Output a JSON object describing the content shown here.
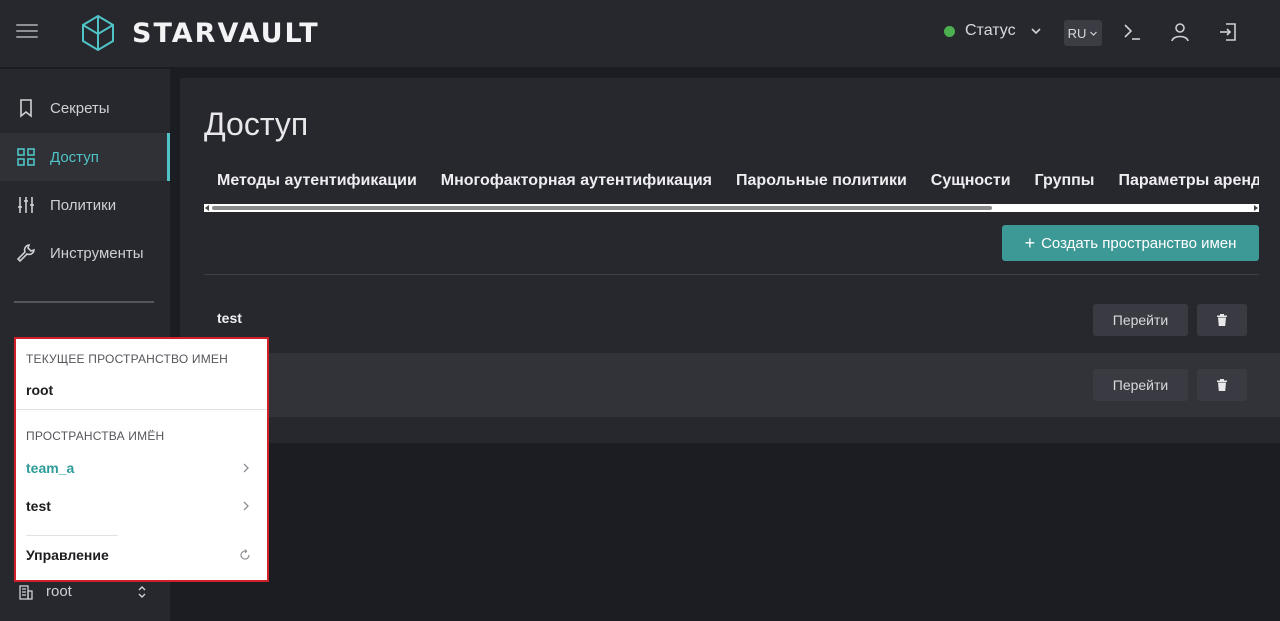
{
  "header": {
    "brand": "STARVAULT",
    "status_label": "Статус",
    "status_color": "#4caf50",
    "lang": "RU",
    "icons": [
      "menu-icon",
      "logo-icon",
      "terminal-icon",
      "user-icon",
      "logout-icon"
    ]
  },
  "sidebar": {
    "items": [
      {
        "label": "Секреты",
        "icon": "bookmark-icon"
      },
      {
        "label": "Доступ",
        "icon": "grid-icon",
        "active": true
      },
      {
        "label": "Политики",
        "icon": "sliders-icon"
      },
      {
        "label": "Инструменты",
        "icon": "wrench-icon"
      }
    ],
    "namespace_current": "root"
  },
  "main": {
    "title": "Доступ",
    "tabs": [
      "Методы аутентификации",
      "Многофакторная аутентификация",
      "Парольные политики",
      "Сущности",
      "Группы",
      "Параметры аренды"
    ],
    "create_button": "Создать пространство имен",
    "rows": [
      {
        "name": "test",
        "go_label": "Перейти"
      },
      {
        "name": "",
        "go_label": "Перейти"
      }
    ]
  },
  "namespace_popup": {
    "current_heading": "ТЕКУЩЕЕ ПРОСТРАНСТВО ИМЕН",
    "current_value": "root",
    "list_heading": "ПРОСТРАНСТВА ИМЁН",
    "items": [
      "team_a",
      "test"
    ],
    "manage_label": "Управление"
  },
  "colors": {
    "accent": "#3d9996",
    "popup_border": "#d0202a"
  }
}
